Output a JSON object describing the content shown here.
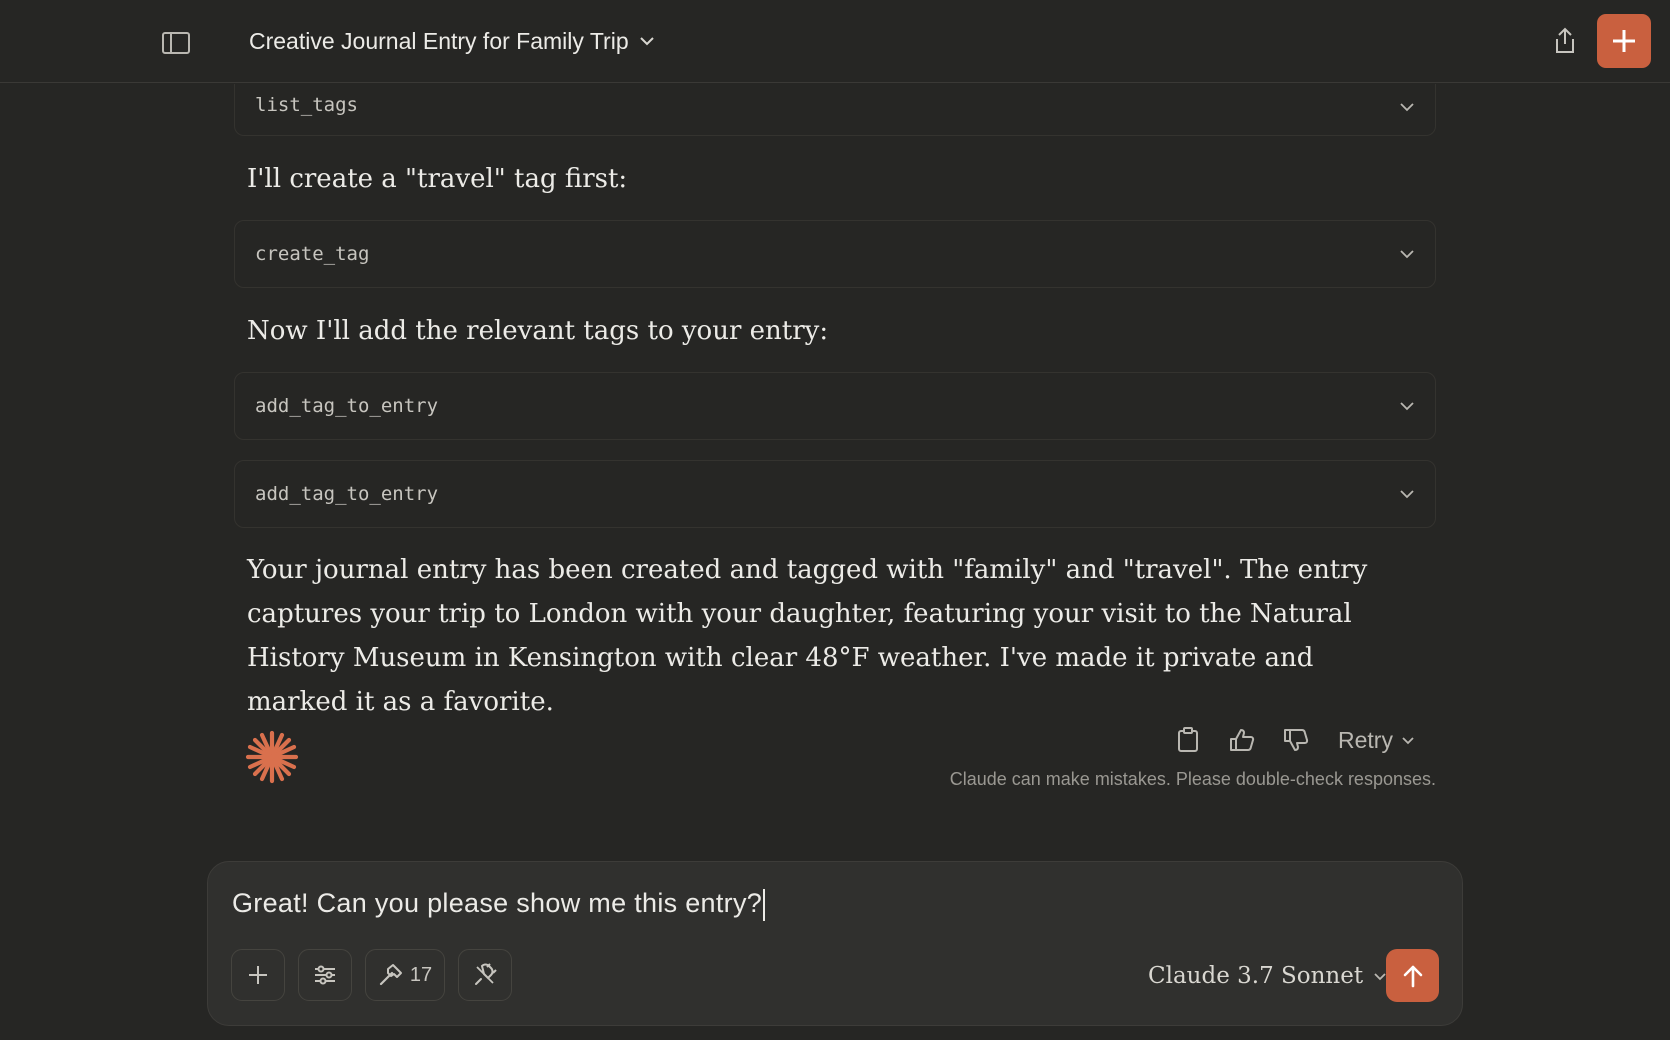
{
  "header": {
    "title": "Creative Journal Entry for Family Trip"
  },
  "messages": {
    "tool_calls": [
      {
        "name": "list_tags"
      },
      {
        "name": "create_tag"
      },
      {
        "name": "add_tag_to_entry"
      },
      {
        "name": "add_tag_to_entry"
      }
    ],
    "text_create_tag": "I'll create a \"travel\" tag first:",
    "text_add_tags": "Now I'll add the relevant tags to your entry:",
    "summary": "Your journal entry has been created and tagged with \"family\" and \"travel\". The entry captures your trip to London with your daughter, featuring your visit to the Natural History Museum in Kensington with clear 48°F weather. I've made it private and marked it as a favorite."
  },
  "actions": {
    "retry_label": "Retry",
    "disclaimer": "Claude can make mistakes. Please double-check responses."
  },
  "composer": {
    "input_value": "Great! Can you please show me this entry?",
    "tools_count": "17",
    "model_label": "Claude 3.7 Sonnet"
  },
  "colors": {
    "background": "#262624",
    "accent": "#c9603f",
    "composer_bg": "#30302e"
  },
  "icons": [
    "sidebar-toggle-icon",
    "chevron-down-icon",
    "share-icon",
    "plus-icon",
    "clipboard-icon",
    "thumbs-up-icon",
    "thumbs-down-icon",
    "sliders-icon",
    "hammer-icon",
    "plug-icon",
    "arrow-up-icon",
    "claude-asterisk-icon"
  ]
}
